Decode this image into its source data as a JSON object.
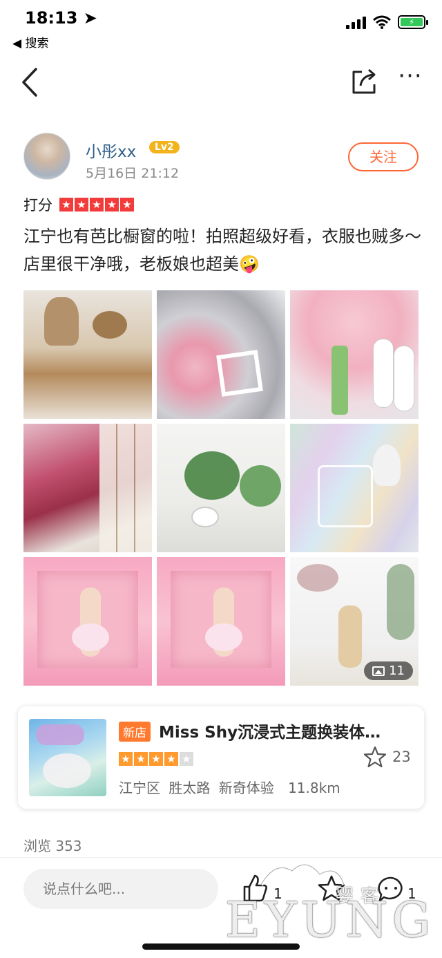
{
  "status_bar": {
    "time": "18:13",
    "back_label": "◀ 搜索"
  },
  "author": {
    "name": "小彤xx",
    "level": "Lv2",
    "date": "5月16日  21:12",
    "follow_label": "关注"
  },
  "rating": {
    "label": "打分",
    "stars": 5
  },
  "review": {
    "text": "江宁也有芭比橱窗的啦！拍照超级好看，衣服也贼多～ 店里很干净哦，老板娘也超美🤪"
  },
  "photos": {
    "count_label": "11"
  },
  "shop": {
    "badge": "新店",
    "name": "Miss Shy沉浸式主题换装体…",
    "stars": 4,
    "favorites": "23",
    "district": "江宁区",
    "street": "胜太路",
    "category": "新奇体验",
    "distance": "11.8km"
  },
  "views": "浏览 353",
  "bottom_bar": {
    "comment_placeholder": "说点什么吧...",
    "like_count": "1",
    "comment_count": "1"
  },
  "watermark": {
    "text": "EYUNG",
    "cn_text": "婴客"
  }
}
